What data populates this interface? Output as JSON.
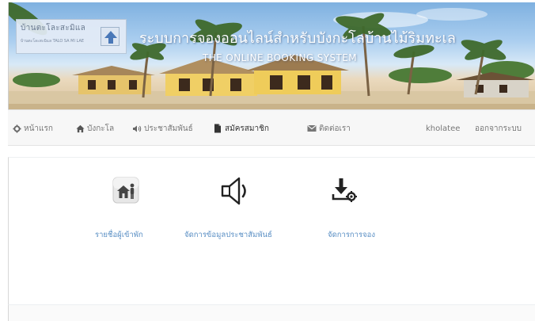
{
  "banner": {
    "logo_text": "บ้านตะโละสะมิแล",
    "logo_sub": "บ้านตะโละสะมิแล TALO SA MI LAE",
    "title": "ระบบการจองออนไลน์สำหรับบังกะโลบ้านไม้ริมทะเล",
    "subtitle": "THE ONLINE BOOKING SYSTEM"
  },
  "nav": {
    "home": "หน้าแรก",
    "bungalow": "บังกะโล",
    "announcements": "ประชาสัมพันธ์",
    "register": "สมัครสมาชิก",
    "contact": "ติดต่อเรา",
    "username": "kholatee",
    "logout": "ออกจากระบบ"
  },
  "tiles": {
    "tenant_list": "รายชื่อผู้เข้าพัก",
    "manage_announcements": "จัดการข้อมูลประชาสัมพันธ์",
    "manage_bookings": "จัดการการจอง"
  },
  "colors": {
    "link": "#5a8fc4",
    "nav_bg": "#f7f7f7",
    "nav_text": "#777777"
  }
}
